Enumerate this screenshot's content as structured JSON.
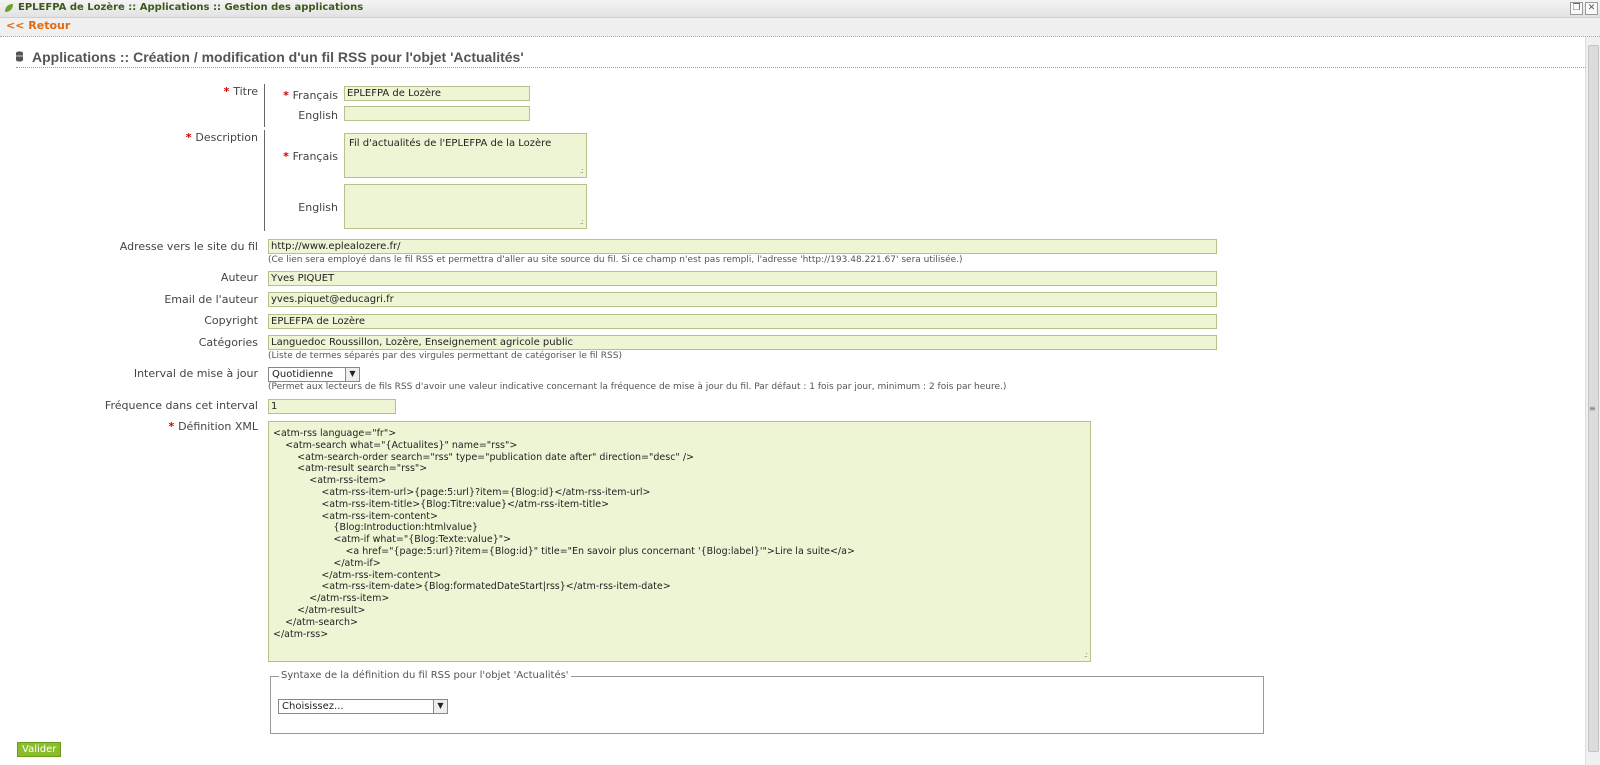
{
  "window": {
    "title": "EPLEFPA de Lozère :: Applications :: Gestion des applications"
  },
  "nav": {
    "back_label": "<< Retour"
  },
  "page": {
    "title": "Applications :: Création / modification d'un fil RSS pour l'objet 'Actualités'"
  },
  "form": {
    "titre": {
      "label": "Titre",
      "fr_label": "Français",
      "fr_value": "EPLEFPA de Lozère",
      "en_label": "English",
      "en_value": ""
    },
    "description": {
      "label": "Description",
      "fr_label": "Français",
      "fr_value": "Fil d'actualités de l'EPLEFPA de la Lozère",
      "en_label": "English",
      "en_value": ""
    },
    "site": {
      "label": "Adresse vers le site du fil",
      "value": "http://www.eplealozere.fr/",
      "hint": "(Ce lien sera employé dans le fil RSS et permettra d'aller au site source du fil. Si ce champ n'est pas rempli, l'adresse 'http://193.48.221.67' sera utilisée.)"
    },
    "auteur": {
      "label": "Auteur",
      "value": "Yves PIQUET"
    },
    "email": {
      "label": "Email de l'auteur",
      "value": "yves.piquet@educagri.fr"
    },
    "copyright": {
      "label": "Copyright",
      "value": "EPLEFPA de Lozère"
    },
    "categories": {
      "label": "Catégories",
      "value": "Languedoc Roussillon, Lozère, Enseignement agricole public",
      "hint": "(Liste de termes séparés par des virgules permettant de catégoriser le fil RSS)"
    },
    "interval": {
      "label": "Interval de mise à jour",
      "value": "Quotidienne",
      "hint": "(Permet aux lecteurs de fils RSS d'avoir une valeur indicative concernant la fréquence de mise à jour du fil. Par défaut : 1 fois par jour, minimum : 2 fois par heure.)"
    },
    "frequence": {
      "label": "Fréquence dans cet interval",
      "value": "1"
    },
    "xml": {
      "label": "Définition XML",
      "lines": [
        "<atm-rss language=\"fr\">",
        "    <atm-search what=\"{Actualites}\" name=\"rss\">",
        "        <atm-search-order search=\"rss\" type=\"publication date after\" direction=\"desc\" />",
        "        <atm-result search=\"rss\">",
        "            <atm-rss-item>",
        "                <atm-rss-item-url>{page:5:url}?item={Blog:id}</atm-rss-item-url>",
        "                <atm-rss-item-title>{Blog:Titre:value}</atm-rss-item-title>",
        "                <atm-rss-item-content>",
        "                    {Blog:Introduction:htmlvalue}",
        "                    <atm-if what=\"{Blog:Texte:value}\">",
        "                        <a href=\"{page:5:url}?item={Blog:id}\" title=\"En savoir plus concernant '{Blog:label}'\">Lire la suite</a>",
        "                    </atm-if>",
        "                </atm-rss-item-content>",
        "                <atm-rss-item-date>{Blog:formatedDateStart|rss}</atm-rss-item-date>",
        "            </atm-rss-item>",
        "        </atm-result>",
        "    </atm-search>",
        "</atm-rss>"
      ]
    },
    "syntax": {
      "legend": "Syntaxe de la définition du fil RSS pour l'objet 'Actualités'",
      "select_value": "Choisissez..."
    },
    "submit_label": "Valider"
  },
  "colors": {
    "field_bg": "#eef5d5",
    "accent": "#8bbd2b",
    "required": "#d40000",
    "back_link": "#e06a10"
  }
}
